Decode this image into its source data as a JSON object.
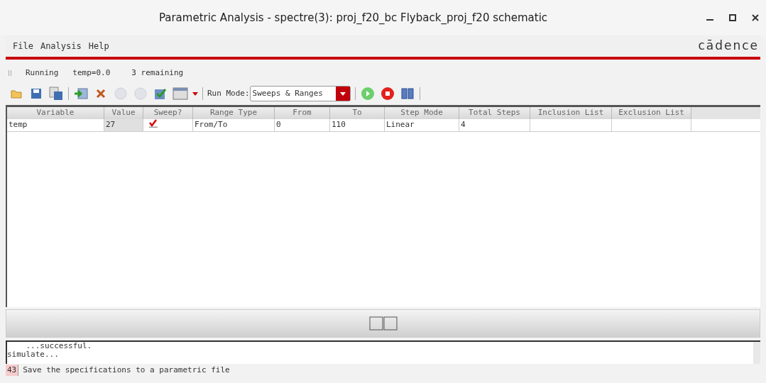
{
  "window": {
    "title": "Parametric Analysis - spectre(3): proj_f20_bc Flyback_proj_f20 schematic"
  },
  "menu": [
    "File",
    "Analysis",
    "Help"
  ],
  "logo": "cādence",
  "run_status": [
    "Running",
    "temp=0.0",
    "3 remaining"
  ],
  "toolbar": {
    "run_mode_label": "Run Mode:",
    "run_mode": "Sweeps & Ranges"
  },
  "table": {
    "columns": [
      "Variable",
      "Value",
      "Sweep?",
      "Range Type",
      "From",
      "To",
      "Step Mode",
      "Total Steps",
      "Inclusion List",
      "Exclusion List"
    ],
    "rows": [
      {
        "variable": "temp",
        "value": "27",
        "sweep": true,
        "range_type": "From/To",
        "from": "0",
        "to": "110",
        "step_mode": "Linear",
        "total_steps": "4"
      }
    ]
  },
  "console": {
    "lines": [
      "    ...successful.",
      "simulate..."
    ]
  },
  "status_line": {
    "number": "43",
    "message": "Save the specifications to a parametric file"
  }
}
